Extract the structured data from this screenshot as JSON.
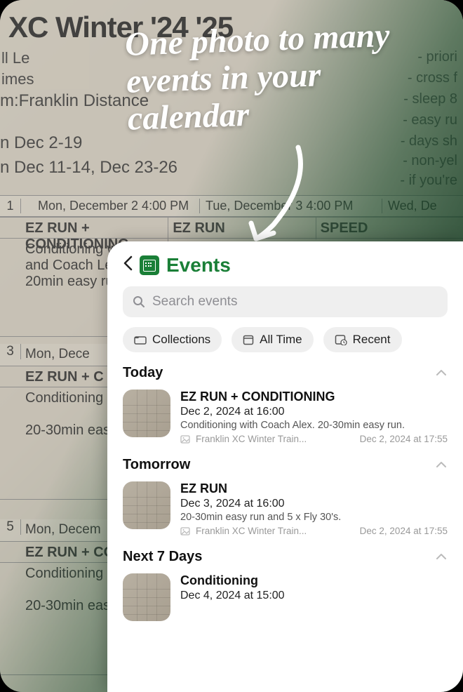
{
  "promo": {
    "headline": "One photo to many events in your calendar"
  },
  "background": {
    "title": "XC Winter '24 '25",
    "ll": "ll Le",
    "times": "imes",
    "franklin": "m:Franklin Distance",
    "dec2": "n Dec 2-19",
    "dec11": "n Dec 11-14, Dec 23-26",
    "right_items": [
      "- priori",
      "- cross f",
      "- sleep 8",
      "- easy ru",
      "- days sh",
      "- non-yel",
      "- if you're"
    ],
    "header_num": "1",
    "header_mon": "Mon, December 2  4:00 PM",
    "header_tue": "Tue, December 3  4:00 PM",
    "header_wed": "Wed, De",
    "row1_title": "EZ RUN + CONDITIONING",
    "row1_col2": "EZ RUN",
    "row1_col3": "SPEED",
    "row1_body": "Conditioning wi\nand Coach Le\n20min easy ru",
    "row3_num": "3",
    "row3_header": "Mon, Dece",
    "row3_title": "EZ RUN + C",
    "row3_body": "Conditioning\n\n20-30min eas",
    "row5_num": "5",
    "row5_header": "Mon, Decem",
    "row5_title": "EZ RUN + CO",
    "row5_body": "Conditioning\n\n20-30min eas"
  },
  "app": {
    "title": "Events",
    "search_placeholder": "Search events",
    "chips": {
      "collections": "Collections",
      "alltime": "All Time",
      "recent": "Recent"
    },
    "sections": [
      {
        "label": "Today",
        "event": {
          "title": "EZ RUN + CONDITIONING",
          "time": "Dec 2, 2024 at 16:00",
          "desc": "Conditioning with Coach Alex. 20-30min easy run.",
          "source": "Franklin XC Winter Train...",
          "created": "Dec 2, 2024 at 17:55"
        }
      },
      {
        "label": "Tomorrow",
        "event": {
          "title": "EZ RUN",
          "time": "Dec 3, 2024 at 16:00",
          "desc": "20-30min easy run and 5 x Fly 30's.",
          "source": "Franklin XC Winter Train...",
          "created": "Dec 2, 2024 at 17:55"
        }
      },
      {
        "label": "Next 7 Days",
        "event": {
          "title": "Conditioning",
          "time": "Dec 4, 2024 at 15:00",
          "desc": "",
          "source": "",
          "created": ""
        }
      }
    ]
  }
}
